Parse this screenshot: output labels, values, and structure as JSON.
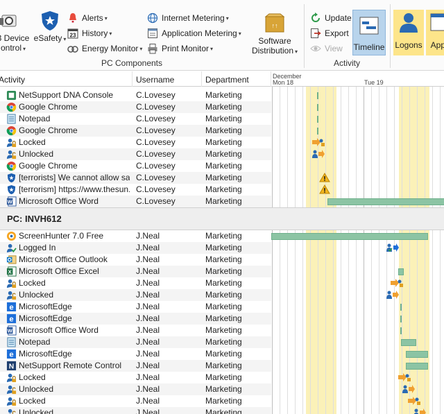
{
  "ribbon": {
    "device_label_line1": "3 Device",
    "device_label_line2": "ontrol",
    "esafety_label": "eSafety",
    "alerts_label": "Alerts",
    "history_label": "History",
    "energy_label": "Energy Monitor",
    "history_icon_text": "23",
    "internet_label": "Internet Metering",
    "application_label": "Application Metering",
    "print_label": "Print Monitor",
    "software_line1": "Software",
    "software_line2": "Distribution",
    "pc_components_label": "PC Components",
    "update_label": "Update",
    "export_label": "Export",
    "view_label": "View",
    "timeline_label": "Timeline",
    "activity_group_label": "Activity",
    "logons_label": "Logons",
    "appli_label": "Appli"
  },
  "grid": {
    "col_activity": "Activity",
    "col_username": "Username",
    "col_department": "Department",
    "month_label": "December",
    "day1_label": "Mon 18",
    "day2_label": "Tue 19"
  },
  "pc_group": {
    "label": "PC:  INVH612"
  },
  "rows_top": [
    {
      "activity": "NetSupport DNA Console",
      "username": "C.Lovesey",
      "department": "Marketing",
      "icon": "netsupport-dna-icon"
    },
    {
      "activity": "Google Chrome",
      "username": "C.Lovesey",
      "department": "Marketing",
      "icon": "chrome-icon"
    },
    {
      "activity": "Notepad",
      "username": "C.Lovesey",
      "department": "Marketing",
      "icon": "notepad-icon"
    },
    {
      "activity": "Google Chrome",
      "username": "C.Lovesey",
      "department": "Marketing",
      "icon": "chrome-icon"
    },
    {
      "activity": "Locked",
      "username": "C.Lovesey",
      "department": "Marketing",
      "icon": "lock-user-icon"
    },
    {
      "activity": "Unlocked",
      "username": "C.Lovesey",
      "department": "Marketing",
      "icon": "unlock-user-icon"
    },
    {
      "activity": "Google Chrome",
      "username": "C.Lovesey",
      "department": "Marketing",
      "icon": "chrome-icon"
    },
    {
      "activity": "[terrorists] We cannot allow safe...",
      "username": "C.Lovesey",
      "department": "Marketing",
      "icon": "esafety-icon"
    },
    {
      "activity": "[terrorism] https://www.thesun....",
      "username": "C.Lovesey",
      "department": "Marketing",
      "icon": "esafety-icon"
    },
    {
      "activity": "Microsoft Office Word",
      "username": "C.Lovesey",
      "department": "Marketing",
      "icon": "word-icon"
    }
  ],
  "rows_bottom": [
    {
      "activity": "ScreenHunter 7.0 Free",
      "username": "J.Neal",
      "department": "Marketing",
      "icon": "screenhunter-icon"
    },
    {
      "activity": "Logged In",
      "username": "J.Neal",
      "department": "Marketing",
      "icon": "logged-in-icon"
    },
    {
      "activity": "Microsoft Office Outlook",
      "username": "J.Neal",
      "department": "Marketing",
      "icon": "outlook-icon"
    },
    {
      "activity": "Microsoft Office Excel",
      "username": "J.Neal",
      "department": "Marketing",
      "icon": "excel-icon"
    },
    {
      "activity": "Locked",
      "username": "J.Neal",
      "department": "Marketing",
      "icon": "lock-user-icon"
    },
    {
      "activity": "Unlocked",
      "username": "J.Neal",
      "department": "Marketing",
      "icon": "unlock-user-icon"
    },
    {
      "activity": "MicrosoftEdge",
      "username": "J.Neal",
      "department": "Marketing",
      "icon": "edge-icon"
    },
    {
      "activity": "MicrosoftEdge",
      "username": "J.Neal",
      "department": "Marketing",
      "icon": "edge-icon"
    },
    {
      "activity": "Microsoft Office Word",
      "username": "J.Neal",
      "department": "Marketing",
      "icon": "word-icon"
    },
    {
      "activity": "Notepad",
      "username": "J.Neal",
      "department": "Marketing",
      "icon": "notepad-icon"
    },
    {
      "activity": "MicrosoftEdge",
      "username": "J.Neal",
      "department": "Marketing",
      "icon": "edge-icon"
    },
    {
      "activity": "NetSupport Remote Control",
      "username": "J.Neal",
      "department": "Marketing",
      "icon": "netsupport-rc-icon"
    },
    {
      "activity": "Locked",
      "username": "J.Neal",
      "department": "Marketing",
      "icon": "lock-user-icon"
    },
    {
      "activity": "Unlocked",
      "username": "J.Neal",
      "department": "Marketing",
      "icon": "unlock-user-icon"
    },
    {
      "activity": "Locked",
      "username": "J.Neal",
      "department": "Marketing",
      "icon": "lock-user-icon"
    },
    {
      "activity": "Unlocked",
      "username": "J.Neal",
      "department": "Marketing",
      "icon": "unlock-user-icon"
    }
  ],
  "colors": {
    "band_yellow": "#fbf1b8",
    "bar_green": "#8cc4a4",
    "arrow_orange": "#f0a030",
    "timeline_active": "#b8d4ec",
    "logons_bg": "#fde58a"
  }
}
